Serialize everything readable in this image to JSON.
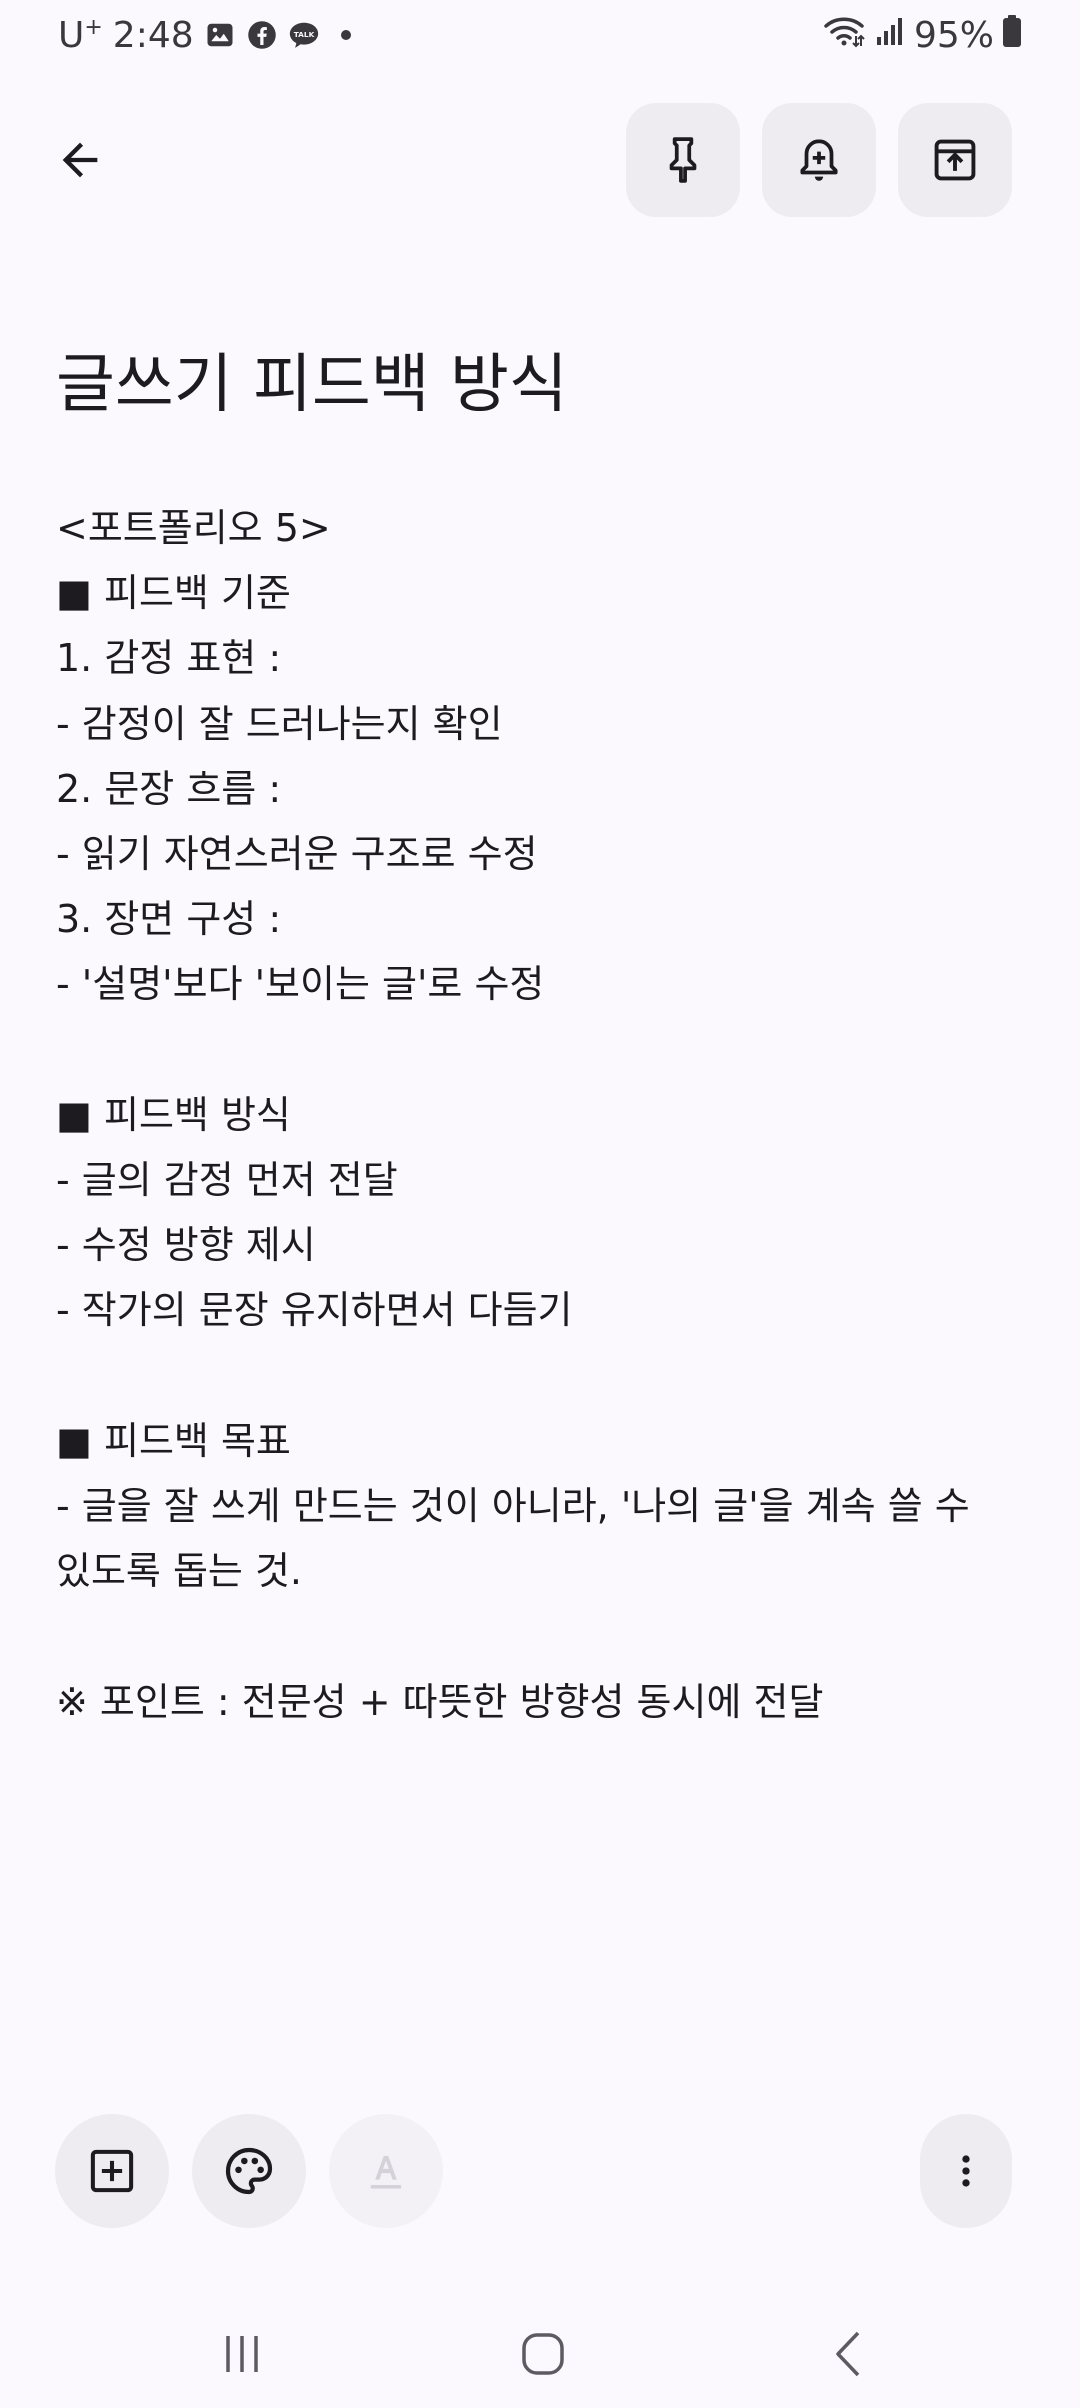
{
  "status_bar": {
    "carrier": "U",
    "carrier_sup": "+",
    "time": "2:48",
    "battery": "95%",
    "icons": [
      "gallery-icon",
      "facebook-icon",
      "kakaotalk-icon",
      "notification-dot-icon",
      "wifi-icon",
      "signal-icon",
      "battery-icon"
    ]
  },
  "toolbar": {
    "icons": [
      "back-arrow-icon",
      "pin-icon",
      "reminder-bell-icon",
      "archive-icon"
    ]
  },
  "note": {
    "title": "글쓰기 피드백 방식",
    "body": "<포트폴리오 5>\n■ 피드백 기준\n1. 감정 표현 :\n- 감정이 잘 드러나는지 확인\n2. 문장 흐름 :\n- 읽기 자연스러운 구조로 수정\n3. 장면 구성 :\n- '설명'보다 '보이는 글'로 수정\n\n■ 피드백 방식\n- 글의 감정 먼저 전달\n- 수정 방향 제시\n- 작가의 문장 유지하면서 다듬기\n\n■ 피드백 목표\n- 글을 잘 쓰게 만드는 것이 아니라, '나의 글'을 계속 쓸 수 있도록 돕는 것.\n\n※ 포인트 : 전문성 + 따뜻한 방향성 동시에 전달"
  },
  "bottom_toolbar": {
    "icons": [
      "add-box-icon",
      "palette-icon",
      "text-format-icon",
      "more-vert-icon"
    ]
  },
  "nav_bar": {
    "icons": [
      "recents-icon",
      "home-icon",
      "back-icon"
    ]
  },
  "colors": {
    "background": "#fbf9fe",
    "button_fill": "#eeebf1",
    "text": "#1d1b20",
    "icon": "#1d1b20",
    "disabled_icon": "#c9c6cc"
  }
}
